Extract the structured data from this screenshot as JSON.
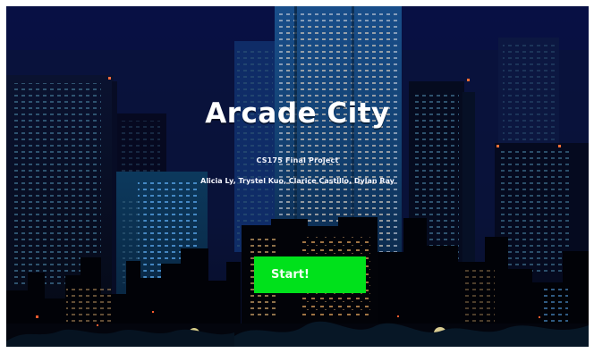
{
  "game": {
    "title": "Arcade City",
    "subtitle": "CS175 Final Project",
    "authors": "Alicia Ly, Trystel Kuo, Clarice Castillo, Dylan Ray",
    "start_label": "Start!"
  },
  "colors": {
    "sky": "#071033",
    "start_button": "#00e11b",
    "window_light": "#f0c06a",
    "window_blue": "#56a8ff"
  }
}
